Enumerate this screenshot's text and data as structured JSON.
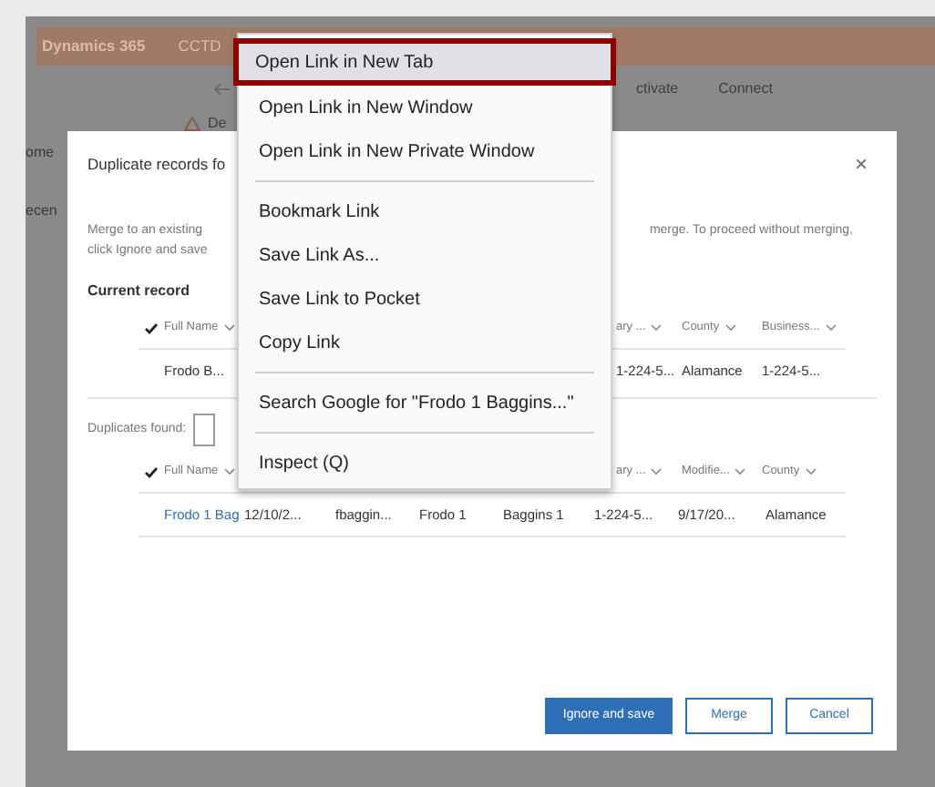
{
  "app_bar": {
    "brand": "Dynamics 365",
    "area": "CCTD"
  },
  "toolbar": {
    "items": [
      "ctivate",
      "Connect"
    ]
  },
  "sidebar": {
    "items": [
      "ome",
      "ecen"
    ]
  },
  "notification": {
    "text": "De"
  },
  "dialog": {
    "title": "Duplicate records fo",
    "close": "×",
    "description": [
      [
        "Merge to an existing",
        "merge. To proceed without merging,"
      ],
      [
        "click Ignore and save"
      ]
    ],
    "current": {
      "label": "Current record",
      "headers": [
        "Full Name",
        "ary ...",
        "County",
        "Business..."
      ],
      "row": [
        "Frodo B...",
        "1-224-5...",
        "Alamance",
        "1-224-5..."
      ]
    },
    "duplicates": {
      "label": "Duplicates found:",
      "headers": [
        "Full Name",
        "ary ...",
        "Modifie...",
        "County"
      ],
      "row": [
        "Frodo 1 Bag",
        "12/10/2...",
        "fbaggin...",
        "Frodo 1",
        "Baggins 1",
        "1-224-5...",
        "9/17/20...",
        "Alamance"
      ]
    },
    "buttons": [
      {
        "label": "Ignore and save",
        "kind": "primary"
      },
      {
        "label": "Merge",
        "kind": "secondary"
      },
      {
        "label": "Cancel",
        "kind": "secondary"
      }
    ]
  },
  "context_menu": {
    "items": [
      {
        "kind": "item",
        "label": "Open Link in New Tab",
        "selected": true
      },
      {
        "kind": "item",
        "label": "Open Link in New Window",
        "selected": false
      },
      {
        "kind": "item",
        "label": "Open Link in New Private Window",
        "selected": false
      },
      {
        "kind": "separator"
      },
      {
        "kind": "item",
        "label": "Bookmark Link",
        "selected": false
      },
      {
        "kind": "item",
        "label": "Save Link As...",
        "selected": false
      },
      {
        "kind": "item",
        "label": "Save Link to Pocket",
        "selected": false
      },
      {
        "kind": "item",
        "label": "Copy Link",
        "selected": false
      },
      {
        "kind": "separator"
      },
      {
        "kind": "item",
        "label": "Search Google for \"Frodo 1 Baggins...\"",
        "selected": false
      },
      {
        "kind": "separator"
      },
      {
        "kind": "item",
        "label": "Inspect (Q)",
        "selected": false
      }
    ]
  }
}
